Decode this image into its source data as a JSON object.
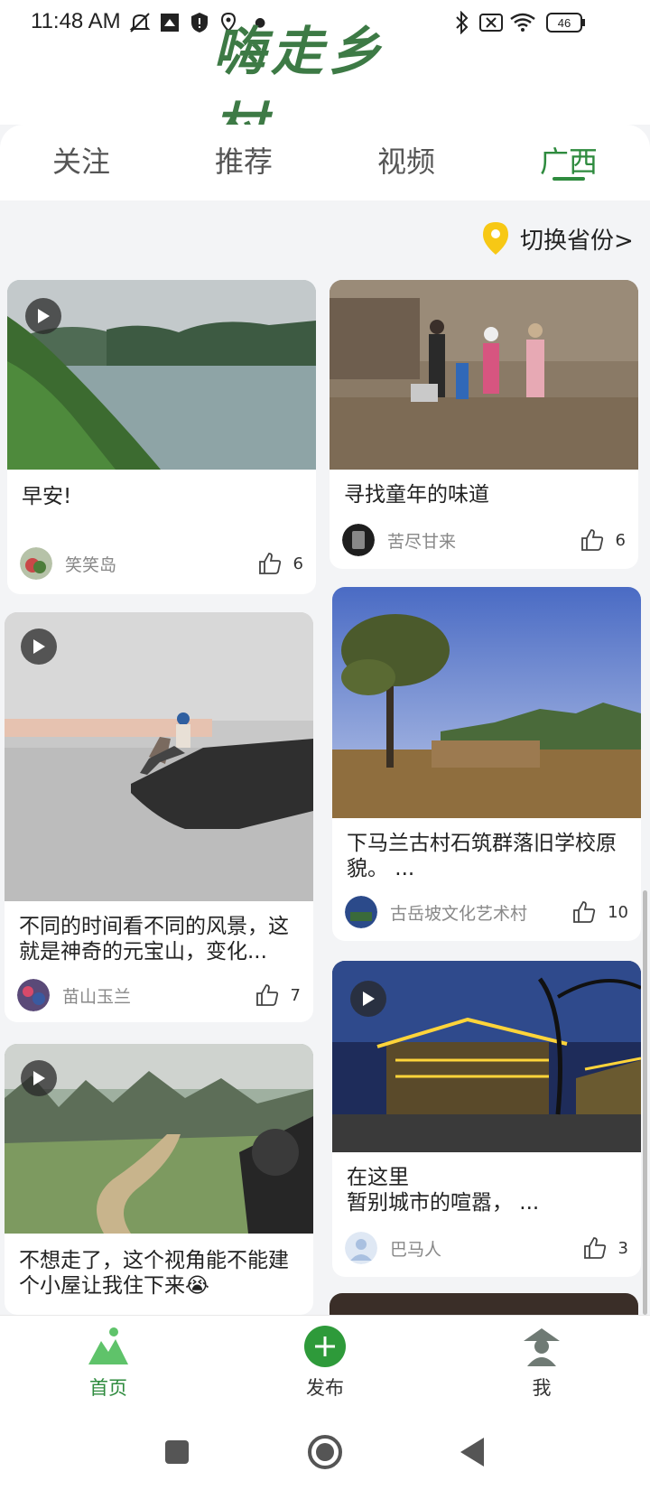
{
  "status_bar": {
    "time": "11:48 AM",
    "battery": "46"
  },
  "app": {
    "logo_text": "嗨走乡村"
  },
  "tabs": [
    {
      "label": "关注",
      "active": false
    },
    {
      "label": "推荐",
      "active": false
    },
    {
      "label": "视频",
      "active": false
    },
    {
      "label": "广西",
      "active": true
    }
  ],
  "location": {
    "switch_label": "切换省份>"
  },
  "feed": {
    "left": [
      {
        "title": "早安!",
        "author": "笑笑岛",
        "likes": "6",
        "video": true
      },
      {
        "title": "不同的时间看不同的风景，这就是神奇的元宝山，变化...",
        "author": "苗山玉兰",
        "likes": "7",
        "video": true
      },
      {
        "title": "不想走了，这个视角能不能建个小屋让我住下来😭",
        "author": "",
        "likes": "",
        "video": true
      }
    ],
    "right": [
      {
        "title": "寻找童年的味道",
        "author": "苦尽甘来",
        "likes": "6",
        "video": false
      },
      {
        "title": "下马兰古村石筑群落旧学校原貌。 ...",
        "author": "古岳坡文化艺术村",
        "likes": "10",
        "video": false
      },
      {
        "title": "在这里\n暂别城市的喧嚣， ...",
        "author": "巴马人",
        "likes": "3",
        "video": true
      }
    ]
  },
  "bottom_nav": [
    {
      "label": "首页",
      "icon": "home-mountain-icon",
      "active": true
    },
    {
      "label": "发布",
      "icon": "plus-circle-icon",
      "active": false
    },
    {
      "label": "我",
      "icon": "profile-icon",
      "active": false
    }
  ],
  "colors": {
    "accent": "#2e8b3e",
    "logo": "#3d7a45",
    "background": "#f3f4f6"
  }
}
